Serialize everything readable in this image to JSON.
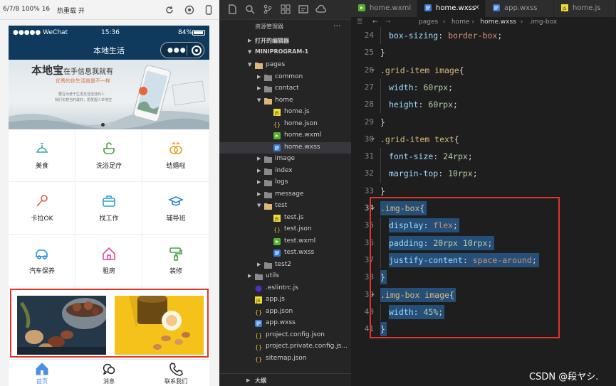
{
  "simulator": {
    "toolbar": {
      "device": "6/7/8 100% 16",
      "hot_reload": "热重载 开"
    },
    "status_bar": {
      "carrier": "●●●●● WeChat",
      "time": "15:36",
      "battery": "84%"
    },
    "nav_title": "本地生活",
    "banner": {
      "title_main": "本地宝",
      "title_sub": "在手信息我就有",
      "subtitle": "优秀的你生活就是不一样",
      "small_line1": "要在为老于生发支活当活的人",
      "small_line2": "我们也想当时最好，把发掘人本地宝"
    },
    "grid": [
      {
        "label": "美食",
        "icon": "food-icon",
        "color": "#3aa8a0"
      },
      {
        "label": "洗浴足疗",
        "icon": "bath-icon",
        "color": "#49a146"
      },
      {
        "label": "结婚啦",
        "icon": "rings-icon",
        "color": "#e8a020"
      },
      {
        "label": "卡拉OK",
        "icon": "microphone-icon",
        "color": "#e05a4a"
      },
      {
        "label": "找工作",
        "icon": "briefcase-icon",
        "color": "#2f9fd8"
      },
      {
        "label": "辅导班",
        "icon": "graduation-cap-icon",
        "color": "#2f7fd8"
      },
      {
        "label": "汽车保养",
        "icon": "car-icon",
        "color": "#2f8fd8"
      },
      {
        "label": "租房",
        "icon": "house-icon",
        "color": "#e0489a"
      },
      {
        "label": "装修",
        "icon": "paint-roller-icon",
        "color": "#49a146"
      }
    ],
    "tabs": [
      {
        "label": "首页",
        "icon": "home-icon",
        "active": true
      },
      {
        "label": "消息",
        "icon": "message-icon",
        "active": false
      },
      {
        "label": "联系我们",
        "icon": "phone-icon",
        "active": false
      }
    ]
  },
  "explorer": {
    "title": "资源管理器",
    "more": "···",
    "sections": {
      "open_editors": "打开的编辑器",
      "project": "MINIPROGRAM-1",
      "outline": "大纲"
    },
    "tree": [
      {
        "name": "pages",
        "type": "folder-open",
        "depth": 1
      },
      {
        "name": "common",
        "type": "folder",
        "depth": 2
      },
      {
        "name": "contact",
        "type": "folder",
        "depth": 2
      },
      {
        "name": "home",
        "type": "folder-open",
        "depth": 2
      },
      {
        "name": "home.js",
        "type": "js",
        "depth": 3
      },
      {
        "name": "home.json",
        "type": "json",
        "depth": 3
      },
      {
        "name": "home.wxml",
        "type": "wxml",
        "depth": 3
      },
      {
        "name": "home.wxss",
        "type": "wxss",
        "depth": 3,
        "selected": true
      },
      {
        "name": "image",
        "type": "folder",
        "depth": 2
      },
      {
        "name": "index",
        "type": "folder",
        "depth": 2
      },
      {
        "name": "logs",
        "type": "folder",
        "depth": 2
      },
      {
        "name": "message",
        "type": "folder",
        "depth": 2
      },
      {
        "name": "test",
        "type": "folder-open",
        "depth": 2
      },
      {
        "name": "test.js",
        "type": "js",
        "depth": 3
      },
      {
        "name": "test.json",
        "type": "json",
        "depth": 3
      },
      {
        "name": "test.wxml",
        "type": "wxml",
        "depth": 3
      },
      {
        "name": "test.wxss",
        "type": "wxss",
        "depth": 3
      },
      {
        "name": "test2",
        "type": "folder",
        "depth": 2
      },
      {
        "name": "utils",
        "type": "folder",
        "depth": 1
      },
      {
        "name": ".eslintrc.js",
        "type": "eslint",
        "depth": 1
      },
      {
        "name": "app.js",
        "type": "js",
        "depth": 1
      },
      {
        "name": "app.json",
        "type": "json",
        "depth": 1
      },
      {
        "name": "app.wxss",
        "type": "wxss",
        "depth": 1
      },
      {
        "name": "project.config.json",
        "type": "json",
        "depth": 1
      },
      {
        "name": "project.private.config.js...",
        "type": "json",
        "depth": 1
      },
      {
        "name": "sitemap.json",
        "type": "json",
        "depth": 1
      }
    ]
  },
  "editor": {
    "tabs": [
      {
        "name": "home.wxml",
        "type": "wxml"
      },
      {
        "name": "home.wxss",
        "type": "wxss",
        "active": true,
        "close": "×"
      },
      {
        "name": "app.wxss",
        "type": "wxss"
      },
      {
        "name": "home.js",
        "type": "js"
      }
    ],
    "breadcrumb": [
      "pages",
      "home",
      "home.wxss",
      ".img-box"
    ],
    "lines": [
      {
        "n": "24",
        "indent": true,
        "tokens": [
          [
            "prop",
            "box-sizing"
          ],
          [
            "punc",
            ": "
          ],
          [
            "val",
            "border-box"
          ],
          [
            "punc",
            ";"
          ]
        ]
      },
      {
        "n": "25",
        "tokens": [
          [
            "punc",
            "}"
          ]
        ]
      },
      {
        "n": "26",
        "fold": true,
        "tokens": [
          [
            "sel",
            ".grid-item image"
          ],
          [
            "punc",
            "{"
          ]
        ]
      },
      {
        "n": "27",
        "indent": true,
        "tokens": [
          [
            "prop",
            "width"
          ],
          [
            "punc",
            ": "
          ],
          [
            "num",
            "60rpx"
          ],
          [
            "punc",
            ";"
          ]
        ]
      },
      {
        "n": "28",
        "indent": true,
        "tokens": [
          [
            "prop",
            "height"
          ],
          [
            "punc",
            ": "
          ],
          [
            "num",
            "60rpx"
          ],
          [
            "punc",
            ";"
          ]
        ]
      },
      {
        "n": "29",
        "tokens": [
          [
            "punc",
            "}"
          ]
        ]
      },
      {
        "n": "30",
        "fold": true,
        "tokens": [
          [
            "sel",
            ".grid-item text"
          ],
          [
            "punc",
            "{"
          ]
        ]
      },
      {
        "n": "31",
        "indent": true,
        "tokens": [
          [
            "prop",
            "font-size"
          ],
          [
            "punc",
            ": "
          ],
          [
            "num",
            "24rpx"
          ],
          [
            "punc",
            ";"
          ]
        ]
      },
      {
        "n": "32",
        "indent": true,
        "tokens": [
          [
            "prop",
            "margin-top"
          ],
          [
            "punc",
            ": "
          ],
          [
            "num",
            "10rpx"
          ],
          [
            "punc",
            ";"
          ]
        ]
      },
      {
        "n": "33",
        "tokens": [
          [
            "punc",
            "}"
          ]
        ]
      },
      {
        "n": "34",
        "fold": true,
        "cur": true,
        "selected": true,
        "tokens": [
          [
            "sel",
            ".img-box"
          ],
          [
            "punc",
            "{"
          ]
        ]
      },
      {
        "n": "35",
        "indent": true,
        "selected": true,
        "tokens": [
          [
            "prop",
            "display"
          ],
          [
            "punc",
            ": "
          ],
          [
            "val",
            "flex"
          ],
          [
            "punc",
            ";"
          ]
        ]
      },
      {
        "n": "36",
        "indent": true,
        "selected": true,
        "tokens": [
          [
            "prop",
            "padding"
          ],
          [
            "punc",
            ": "
          ],
          [
            "num",
            "20rpx"
          ],
          [
            "punc",
            " "
          ],
          [
            "num",
            "10rpx"
          ],
          [
            "punc",
            ";"
          ]
        ]
      },
      {
        "n": "37",
        "indent": true,
        "selected": true,
        "tokens": [
          [
            "prop",
            "justify-content"
          ],
          [
            "punc",
            ": "
          ],
          [
            "val",
            "space-around"
          ],
          [
            "punc",
            ";"
          ]
        ]
      },
      {
        "n": "38",
        "selected": true,
        "tokens": [
          [
            "punc",
            "}"
          ]
        ]
      },
      {
        "n": "39",
        "fold": true,
        "selected": true,
        "tokens": [
          [
            "sel",
            ".img-box image"
          ],
          [
            "punc",
            "{"
          ]
        ]
      },
      {
        "n": "40",
        "indent": true,
        "selected": true,
        "tokens": [
          [
            "prop",
            "width"
          ],
          [
            "punc",
            ": "
          ],
          [
            "num",
            "45%"
          ],
          [
            "punc",
            ";"
          ]
        ]
      },
      {
        "n": "41",
        "selected": true,
        "tokens": [
          [
            "punc",
            "}"
          ]
        ]
      }
    ]
  },
  "watermark": "CSDN @段ヤシ."
}
